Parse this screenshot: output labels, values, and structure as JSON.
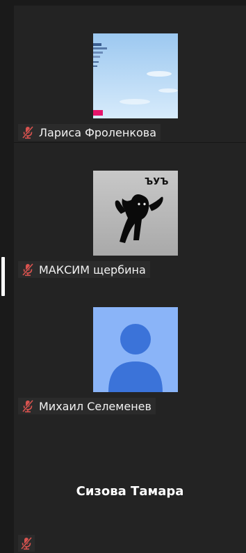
{
  "participants": [
    {
      "name": "Лариса Фроленкова",
      "muted": true,
      "avatar": "document-photo"
    },
    {
      "name": "МАКСИМ щербина",
      "muted": true,
      "avatar": "cat-meme",
      "avatar_caption": "ЪУЪ"
    },
    {
      "name": "Михаил Селеменев",
      "muted": true,
      "avatar": "default-person-icon"
    },
    {
      "name": "Сизова Тамара",
      "muted": true,
      "avatar": "none"
    }
  ],
  "icons": {
    "mute": "microphone-muted-icon"
  },
  "colors": {
    "mute_red": "#d9534f",
    "default_avatar_bg": "#8ab4f8",
    "default_avatar_fg": "#3b73d9"
  }
}
